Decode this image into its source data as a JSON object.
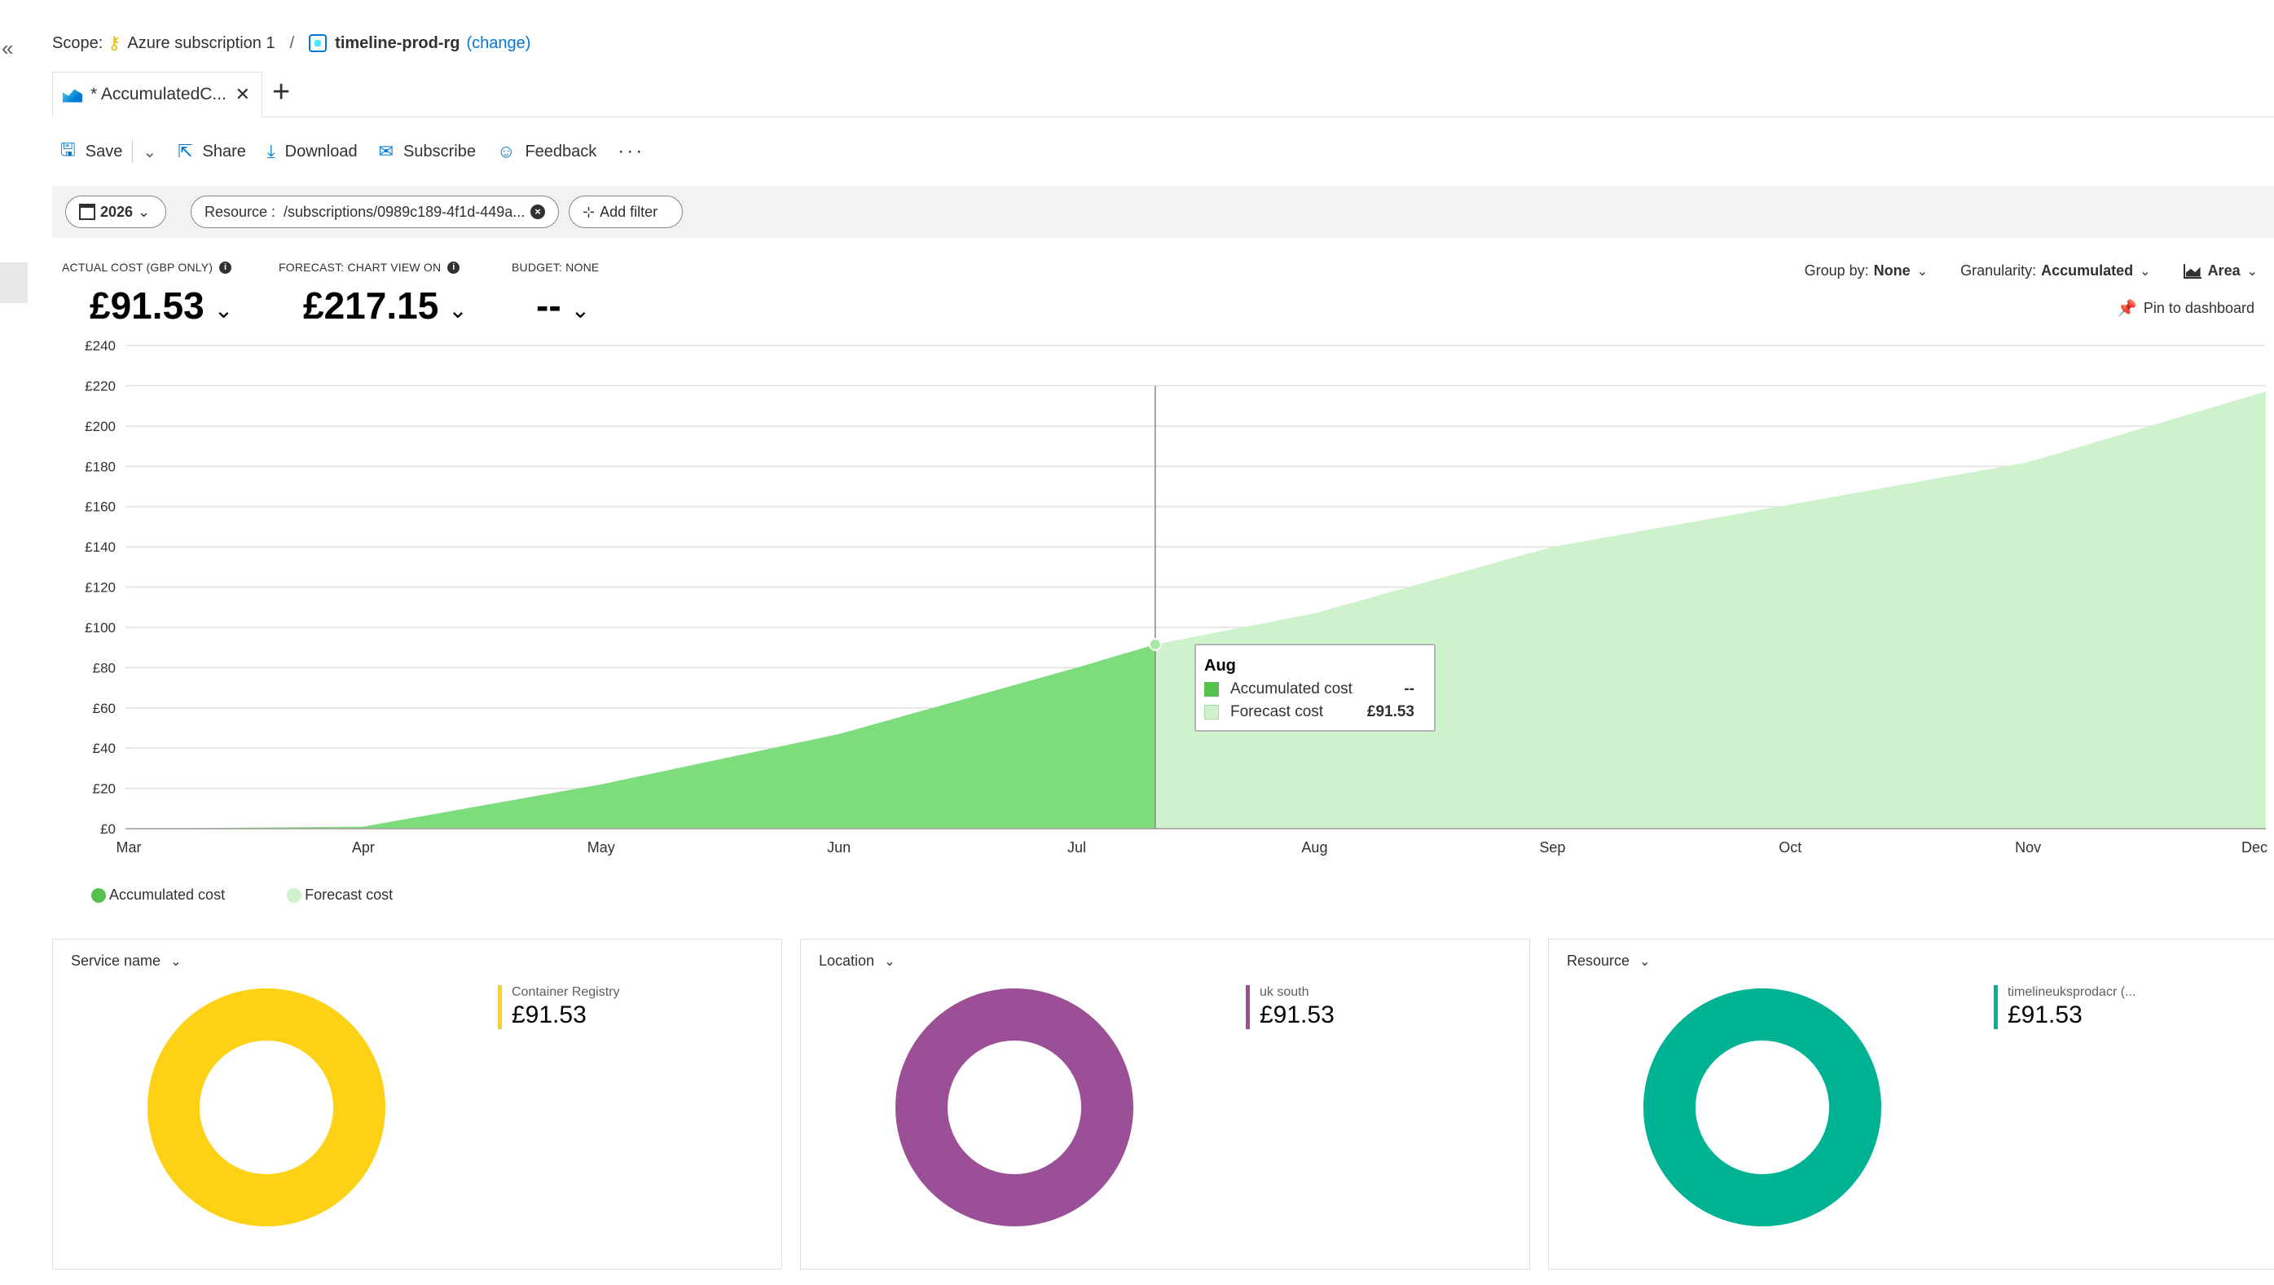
{
  "nav": {
    "collapse": "«"
  },
  "scope": {
    "label": "Scope:",
    "subscription": "Azure subscription 1",
    "separator": "/",
    "resource_group": "timeline-prod-rg",
    "change_open": "(",
    "change_label": "change",
    "change_close": ")"
  },
  "tabs": [
    {
      "label": "* AccumulatedC...",
      "close": "✕"
    }
  ],
  "tab_add": "+",
  "toolbar": {
    "save": "Save",
    "share": "Share",
    "download": "Download",
    "subscribe": "Subscribe",
    "feedback": "Feedback",
    "more": "···"
  },
  "filters": {
    "date": "2026",
    "resource_key": "Resource :",
    "resource_value": "/subscriptions/0989c189-4f1d-449a...",
    "add_filter": "Add filter"
  },
  "kpis": {
    "actual_label": "ACTUAL COST (GBP ONLY)",
    "actual_value": "£91.53",
    "forecast_label": "FORECAST: CHART VIEW ON",
    "forecast_value": "£217.15",
    "budget_label": "BUDGET: NONE",
    "budget_value": "--"
  },
  "view_controls": {
    "group_by_label": "Group by:",
    "group_by_value": "None",
    "granularity_label": "Granularity:",
    "granularity_value": "Accumulated",
    "chart_type": "Area",
    "pin": "Pin to dashboard"
  },
  "colors": {
    "actual": "#7ddc7b",
    "forecast": "#cdf2cc",
    "service": "#fcd116",
    "location": "#9b4f96",
    "resource": "#00b294",
    "accent": "#0078d4"
  },
  "chart_data": {
    "type": "area",
    "x": [
      "Mar",
      "Apr",
      "May",
      "Jun",
      "Jul",
      "Aug",
      "Sep",
      "Oct",
      "Nov",
      "Dec"
    ],
    "ylim": [
      0,
      240
    ],
    "y_ticks": [
      "£0",
      "£20",
      "£40",
      "£60",
      "£80",
      "£100",
      "£120",
      "£140",
      "£160",
      "£180",
      "£200",
      "£220",
      "£240"
    ],
    "series": [
      {
        "name": "Accumulated cost",
        "points": [
          [
            0,
            0
          ],
          [
            1,
            1
          ],
          [
            2,
            22
          ],
          [
            3,
            47
          ],
          [
            4,
            80
          ],
          [
            4.33,
            91.53
          ]
        ]
      },
      {
        "name": "Forecast cost",
        "points": [
          [
            4.33,
            91.53
          ],
          [
            5,
            107
          ],
          [
            6,
            140
          ],
          [
            7,
            161
          ],
          [
            8,
            182
          ],
          [
            9,
            217.15
          ]
        ]
      }
    ],
    "grid": true,
    "legend": "bottom-left"
  },
  "legend": {
    "actual": "Accumulated cost",
    "forecast": "Forecast cost"
  },
  "tooltip": {
    "title": "Aug",
    "rows": [
      {
        "label": "Accumulated cost",
        "value": "--"
      },
      {
        "label": "Forecast cost",
        "value": "£91.53"
      }
    ]
  },
  "breakdowns": [
    {
      "title": "Service name",
      "item": "Container Registry",
      "value": "£91.53",
      "color": "#fcd116"
    },
    {
      "title": "Location",
      "item": "uk south",
      "value": "£91.53",
      "color": "#9b4f96"
    },
    {
      "title": "Resource",
      "item": "timelineuksprodacr (...",
      "value": "£91.53",
      "color": "#00b294"
    }
  ]
}
